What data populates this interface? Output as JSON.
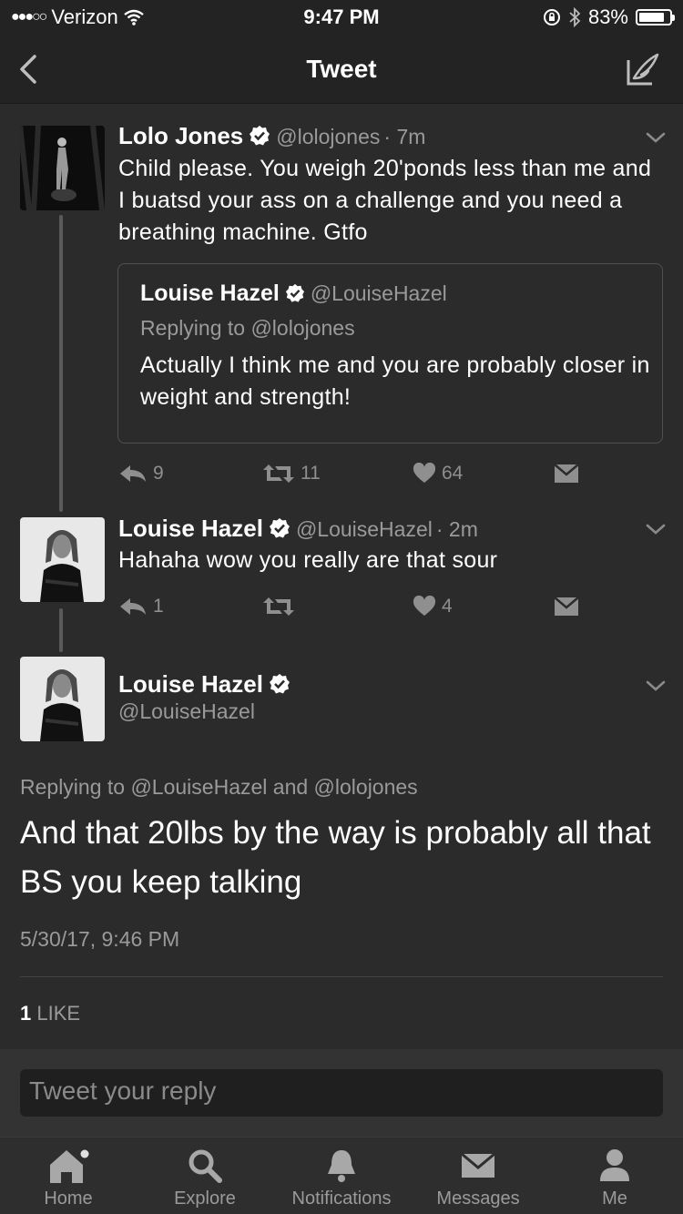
{
  "status_bar": {
    "carrier": "Verizon",
    "time": "9:47 PM",
    "battery": "83%",
    "battery_level": 0.83
  },
  "nav": {
    "title": "Tweet"
  },
  "tweet1": {
    "name": "Lolo Jones",
    "handle": "@lolojones",
    "time": "· 7m",
    "text": "Child please. You weigh 20'ponds less than me and I buatsd your ass on a challenge and you need a breathing machine. Gtfo",
    "quote": {
      "name": "Louise Hazel",
      "handle": "@LouiseHazel",
      "replying": "Replying to @lolojones",
      "text": "Actually I think me and you are probably closer in weight and strength!"
    },
    "replies": "9",
    "retweets": "11",
    "likes": "64"
  },
  "tweet2": {
    "name": "Louise Hazel",
    "handle": "@LouiseHazel",
    "time": "· 2m",
    "text": "Hahaha wow you really are that sour",
    "replies": "1",
    "retweets": "",
    "likes": "4"
  },
  "main": {
    "name": "Louise Hazel",
    "handle": "@LouiseHazel",
    "replying": "Replying to @LouiseHazel and @lolojones",
    "text": "And that 20lbs by the way is probably all that BS you keep talking",
    "timestamp": "5/30/17, 9:46 PM",
    "like_count": "1",
    "like_label": "LIKE"
  },
  "reply": {
    "placeholder": "Tweet your reply"
  },
  "tabs": [
    {
      "label": "Home",
      "icon": "home-icon"
    },
    {
      "label": "Explore",
      "icon": "search-icon"
    },
    {
      "label": "Notifications",
      "icon": "bell-icon"
    },
    {
      "label": "Messages",
      "icon": "envelope-icon"
    },
    {
      "label": "Me",
      "icon": "person-icon"
    }
  ],
  "colors": {
    "background": "#2b2b2c",
    "bar": "#232324",
    "muted": "#9a9a9a"
  }
}
